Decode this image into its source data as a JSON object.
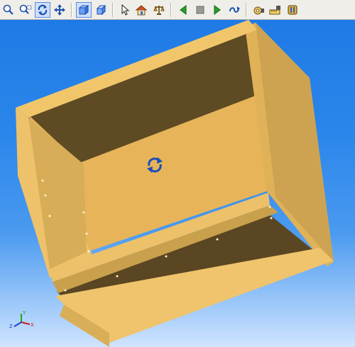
{
  "toolbar": {
    "buttons": [
      {
        "name": "zoom-icon",
        "group": 1
      },
      {
        "name": "zoom-window-icon",
        "group": 1
      },
      {
        "name": "rotate-icon",
        "group": 1,
        "pressed": true
      },
      {
        "name": "pan-icon",
        "group": 1
      },
      {
        "name": "shaded-view-icon",
        "group": 2,
        "pressed": true
      },
      {
        "name": "wireframe-view-icon",
        "group": 2
      },
      {
        "name": "select-pointer-icon",
        "group": 3
      },
      {
        "name": "home-view-icon",
        "group": 3
      },
      {
        "name": "balance-icon",
        "group": 3
      },
      {
        "name": "play-back-icon",
        "group": 4
      },
      {
        "name": "stop-icon",
        "group": 4
      },
      {
        "name": "play-forward-icon",
        "group": 4
      },
      {
        "name": "loop-icon",
        "group": 4
      },
      {
        "name": "camera-settings-icon",
        "group": 5
      },
      {
        "name": "measure-icon",
        "group": 5
      },
      {
        "name": "materials-icon",
        "group": 5
      }
    ]
  },
  "viewport": {
    "background_top": "#1f7ae6",
    "background_bottom": "#cfe4ff",
    "model_color": "#e8b85a",
    "rotate_cursor": "rotate-cursor-icon",
    "triad": {
      "x_label": "X",
      "y_label": "Y",
      "z_label": "Z"
    }
  }
}
